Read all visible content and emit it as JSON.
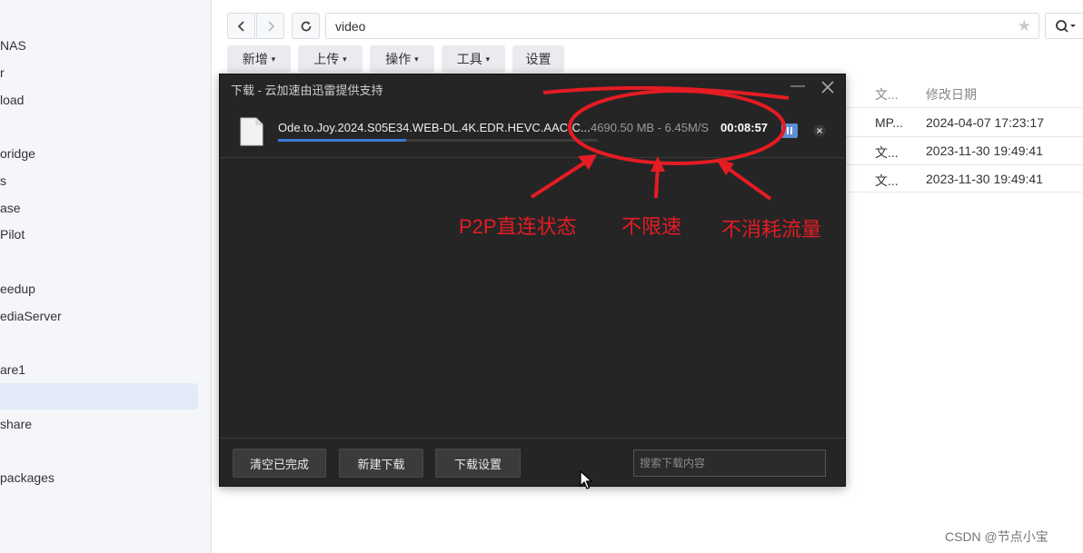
{
  "sidebar": {
    "items": [
      "",
      "NAS",
      "r",
      "load",
      "oridge",
      "s",
      "ase",
      "Pilot",
      "eedup",
      "ediaServer",
      "are1",
      "",
      "share",
      "packages"
    ]
  },
  "toolbar": {
    "path": "video",
    "buttons": [
      "新增",
      "上传",
      "操作",
      "工具",
      "设置"
    ]
  },
  "file_list": {
    "columns": [
      "文...",
      "修改日期"
    ],
    "rows": [
      {
        "type": "MP...",
        "date": "2024-04-07 17:23:17"
      },
      {
        "type": "文...",
        "date": "2023-11-30 19:49:41"
      },
      {
        "type": "文...",
        "date": "2023-11-30 19:49:41"
      }
    ]
  },
  "download_dialog": {
    "title": "下载 - 云加速由迅雷提供支持",
    "task": {
      "filename": "Ode.to.Joy.2024.S05E34.WEB-DL.4K.EDR.HEVC.AAC-C...",
      "size_speed": "4690.50 MB - 6.45M/S",
      "time": "00:08:57",
      "progress": 0.4
    },
    "footer": {
      "clear_label": "清空已完成",
      "new_label": "新建下载",
      "settings_label": "下载设置",
      "search_placeholder": "搜索下载内容"
    }
  },
  "annotations": [
    "P2P直连状态",
    "不限速",
    "不消耗流量"
  ],
  "watermark": "CSDN @节点小宝",
  "colors": {
    "annotation_red": "#e51c23",
    "progress_blue": "#3a7bd5",
    "dialog_bg": "#252526"
  }
}
